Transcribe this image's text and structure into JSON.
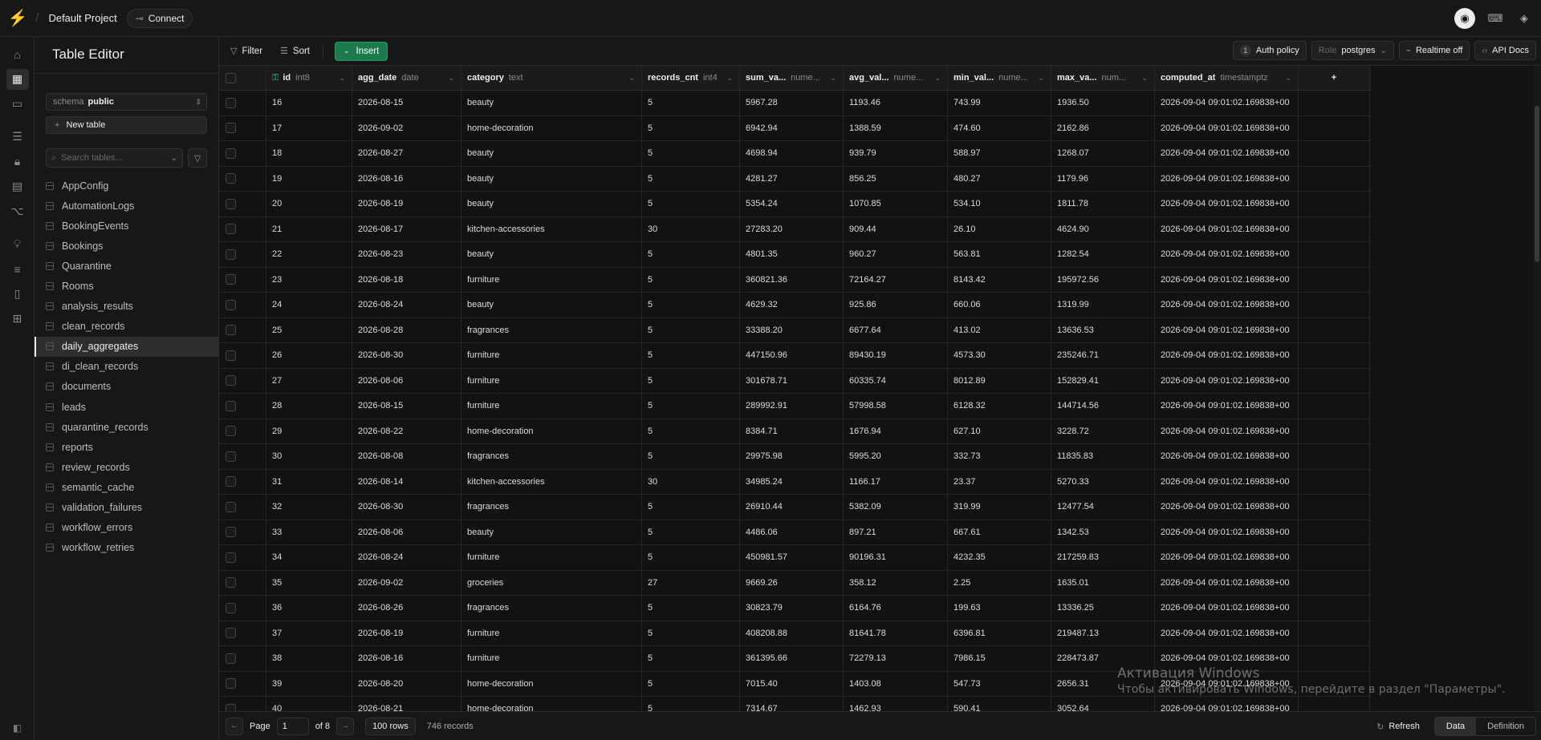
{
  "app": {
    "project_name": "Default Project",
    "connect_label": "Connect"
  },
  "sidebar": {
    "title": "Table Editor",
    "schema_label": "schema",
    "schema_value": "public",
    "new_table_label": "New table",
    "search_placeholder": "Search tables...",
    "tables": [
      "AppConfig",
      "AutomationLogs",
      "BookingEvents",
      "Bookings",
      "Quarantine",
      "Rooms",
      "analysis_results",
      "clean_records",
      "daily_aggregates",
      "di_clean_records",
      "documents",
      "leads",
      "quarantine_records",
      "reports",
      "review_records",
      "semantic_cache",
      "validation_failures",
      "workflow_errors",
      "workflow_retries"
    ],
    "active_table": "daily_aggregates"
  },
  "toolbar": {
    "filter_label": "Filter",
    "sort_label": "Sort",
    "insert_label": "Insert",
    "auth_policy_count": "1",
    "auth_policy_label": "Auth policy",
    "role_label": "Role",
    "role_value": "postgres",
    "realtime_label": "Realtime off",
    "api_docs_label": "API Docs"
  },
  "columns": [
    {
      "name": "id",
      "type": "int8"
    },
    {
      "name": "agg_date",
      "type": "date"
    },
    {
      "name": "category",
      "type": "text"
    },
    {
      "name": "records_cnt",
      "type": "int4"
    },
    {
      "name": "sum_va...",
      "type": "nume..."
    },
    {
      "name": "avg_val...",
      "type": "nume..."
    },
    {
      "name": "min_val...",
      "type": "nume..."
    },
    {
      "name": "max_va...",
      "type": "num..."
    },
    {
      "name": "computed_at",
      "type": "timestamptz"
    }
  ],
  "rows": [
    [
      "16",
      "2026-08-15",
      "beauty",
      "5",
      "5967.28",
      "1193.46",
      "743.99",
      "1936.50",
      "2026-09-04 09:01:02.169838+00"
    ],
    [
      "17",
      "2026-09-02",
      "home-decoration",
      "5",
      "6942.94",
      "1388.59",
      "474.60",
      "2162.86",
      "2026-09-04 09:01:02.169838+00"
    ],
    [
      "18",
      "2026-08-27",
      "beauty",
      "5",
      "4698.94",
      "939.79",
      "588.97",
      "1268.07",
      "2026-09-04 09:01:02.169838+00"
    ],
    [
      "19",
      "2026-08-16",
      "beauty",
      "5",
      "4281.27",
      "856.25",
      "480.27",
      "1179.96",
      "2026-09-04 09:01:02.169838+00"
    ],
    [
      "20",
      "2026-08-19",
      "beauty",
      "5",
      "5354.24",
      "1070.85",
      "534.10",
      "1811.78",
      "2026-09-04 09:01:02.169838+00"
    ],
    [
      "21",
      "2026-08-17",
      "kitchen-accessories",
      "30",
      "27283.20",
      "909.44",
      "26.10",
      "4624.90",
      "2026-09-04 09:01:02.169838+00"
    ],
    [
      "22",
      "2026-08-23",
      "beauty",
      "5",
      "4801.35",
      "960.27",
      "563.81",
      "1282.54",
      "2026-09-04 09:01:02.169838+00"
    ],
    [
      "23",
      "2026-08-18",
      "furniture",
      "5",
      "360821.36",
      "72164.27",
      "8143.42",
      "195972.56",
      "2026-09-04 09:01:02.169838+00"
    ],
    [
      "24",
      "2026-08-24",
      "beauty",
      "5",
      "4629.32",
      "925.86",
      "660.06",
      "1319.99",
      "2026-09-04 09:01:02.169838+00"
    ],
    [
      "25",
      "2026-08-28",
      "fragrances",
      "5",
      "33388.20",
      "6677.64",
      "413.02",
      "13636.53",
      "2026-09-04 09:01:02.169838+00"
    ],
    [
      "26",
      "2026-08-30",
      "furniture",
      "5",
      "447150.96",
      "89430.19",
      "4573.30",
      "235246.71",
      "2026-09-04 09:01:02.169838+00"
    ],
    [
      "27",
      "2026-08-06",
      "furniture",
      "5",
      "301678.71",
      "60335.74",
      "8012.89",
      "152829.41",
      "2026-09-04 09:01:02.169838+00"
    ],
    [
      "28",
      "2026-08-15",
      "furniture",
      "5",
      "289992.91",
      "57998.58",
      "6128.32",
      "144714.56",
      "2026-09-04 09:01:02.169838+00"
    ],
    [
      "29",
      "2026-08-22",
      "home-decoration",
      "5",
      "8384.71",
      "1676.94",
      "627.10",
      "3228.72",
      "2026-09-04 09:01:02.169838+00"
    ],
    [
      "30",
      "2026-08-08",
      "fragrances",
      "5",
      "29975.98",
      "5995.20",
      "332.73",
      "11835.83",
      "2026-09-04 09:01:02.169838+00"
    ],
    [
      "31",
      "2026-08-14",
      "kitchen-accessories",
      "30",
      "34985.24",
      "1166.17",
      "23.37",
      "5270.33",
      "2026-09-04 09:01:02.169838+00"
    ],
    [
      "32",
      "2026-08-30",
      "fragrances",
      "5",
      "26910.44",
      "5382.09",
      "319.99",
      "12477.54",
      "2026-09-04 09:01:02.169838+00"
    ],
    [
      "33",
      "2026-08-06",
      "beauty",
      "5",
      "4486.06",
      "897.21",
      "667.61",
      "1342.53",
      "2026-09-04 09:01:02.169838+00"
    ],
    [
      "34",
      "2026-08-24",
      "furniture",
      "5",
      "450981.57",
      "90196.31",
      "4232.35",
      "217259.83",
      "2026-09-04 09:01:02.169838+00"
    ],
    [
      "35",
      "2026-09-02",
      "groceries",
      "27",
      "9669.26",
      "358.12",
      "2.25",
      "1635.01",
      "2026-09-04 09:01:02.169838+00"
    ],
    [
      "36",
      "2026-08-26",
      "fragrances",
      "5",
      "30823.79",
      "6164.76",
      "199.63",
      "13336.25",
      "2026-09-04 09:01:02.169838+00"
    ],
    [
      "37",
      "2026-08-19",
      "furniture",
      "5",
      "408208.88",
      "81641.78",
      "6396.81",
      "219487.13",
      "2026-09-04 09:01:02.169838+00"
    ],
    [
      "38",
      "2026-08-16",
      "furniture",
      "5",
      "361395.66",
      "72279.13",
      "7986.15",
      "228473.87",
      "2026-09-04 09:01:02.169838+00"
    ],
    [
      "39",
      "2026-08-20",
      "home-decoration",
      "5",
      "7015.40",
      "1403.08",
      "547.73",
      "2656.31",
      "2026-09-04 09:01:02.169838+00"
    ],
    [
      "40",
      "2026-08-21",
      "home-decoration",
      "5",
      "7314.67",
      "1462.93",
      "590.41",
      "3052.64",
      "2026-09-04 09:01:02.169838+00"
    ]
  ],
  "footer": {
    "page_label": "Page",
    "page_value": "1",
    "of_label": "of 8",
    "rows_label": "100 rows",
    "records_label": "746 records",
    "refresh_label": "Refresh",
    "data_tab": "Data",
    "definition_tab": "Definition"
  },
  "watermark": {
    "line1": "Активация Windows",
    "line2": "Чтобы активировать Windows, перейдите в раздел \"Параметры\"."
  },
  "colors": {
    "accent": "#3ecf8e",
    "insert_button": "#1b7a4c",
    "background": "#121212"
  }
}
